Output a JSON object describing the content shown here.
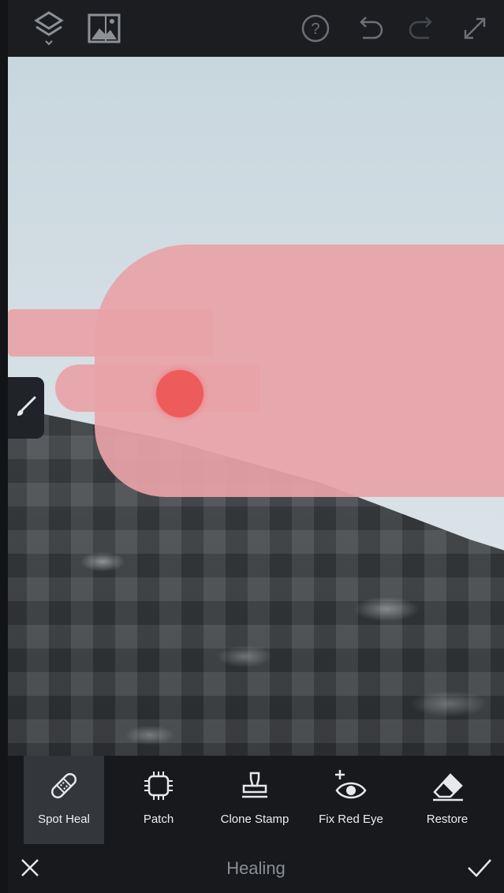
{
  "header": {
    "icons": [
      "layers-icon",
      "image-adjust-icon",
      "help-icon",
      "undo-icon",
      "redo-icon",
      "expand-icon"
    ]
  },
  "canvas": {
    "brush_toggle_icon": "brush-icon"
  },
  "tools": [
    {
      "label": "Spot Heal",
      "icon": "bandage-icon",
      "active": true
    },
    {
      "label": "Patch",
      "icon": "patch-icon",
      "active": false
    },
    {
      "label": "Clone Stamp",
      "icon": "stamp-icon",
      "active": false
    },
    {
      "label": "Fix Red Eye",
      "icon": "eye-plus-icon",
      "active": false
    },
    {
      "label": "Restore",
      "icon": "eraser-icon",
      "active": false
    }
  ],
  "footer": {
    "title": "Healing",
    "cancel_icon": "close-icon",
    "confirm_icon": "check-icon"
  },
  "colors": {
    "mask": "#e8a3a8",
    "brush": "#ee5b5b",
    "active_tool_bg": "#33363b"
  }
}
